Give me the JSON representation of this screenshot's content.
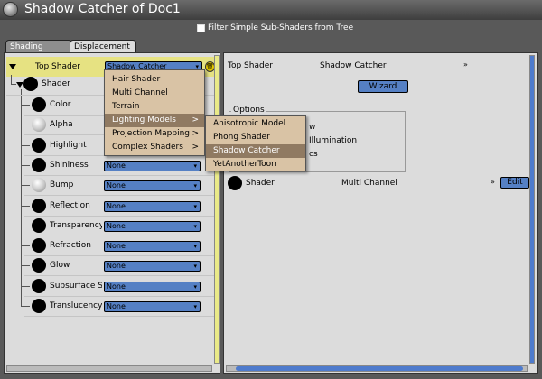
{
  "window": {
    "title": "Shadow Catcher of Doc1"
  },
  "filter": {
    "label": "Filter Simple Sub-Shaders from Tree"
  },
  "tabs": [
    "Shading",
    "Displacement"
  ],
  "top_shader": {
    "label": "Top Shader",
    "value": "Shadow Catcher"
  },
  "tree": {
    "shader_label": "Shader",
    "items": [
      {
        "label": "Color",
        "value": ""
      },
      {
        "label": "Alpha",
        "value": ""
      },
      {
        "label": "Highlight",
        "value": ""
      },
      {
        "label": "Shininess",
        "value": "None"
      },
      {
        "label": "Bump",
        "value": "None"
      },
      {
        "label": "Reflection",
        "value": "None"
      },
      {
        "label": "Transparency",
        "value": "None"
      },
      {
        "label": "Refraction",
        "value": "None"
      },
      {
        "label": "Glow",
        "value": "None"
      },
      {
        "label": "Subsurface Sc",
        "value": "None"
      },
      {
        "label": "Translucency",
        "value": "None"
      }
    ]
  },
  "menu": {
    "items": [
      "Hair Shader",
      "Multi Channel",
      "Terrain",
      "Lighting Models",
      "Projection Mapping",
      "Complex Shaders"
    ],
    "submenu_arrow": ">",
    "highlighted": "Lighting Models"
  },
  "submenu": {
    "items": [
      "Anisotropic Model",
      "Phong Shader",
      "Shadow Catcher",
      "YetAnotherToon"
    ],
    "highlighted": "Shadow Catcher"
  },
  "right": {
    "top_label": "Top Shader",
    "top_value": "Shadow Catcher",
    "wizard_label": "Wizard",
    "options_label": "Options",
    "options_partial": [
      "w",
      "Illumination",
      "cs"
    ],
    "shader_label": "Shader",
    "shader_value": "Multi Channel",
    "edit_label": "Edit"
  },
  "icons": {
    "trash": "trash-icon",
    "close": "close-icon",
    "chevron": "double-chevron-icon"
  },
  "colors": {
    "accent_blue": "#5580c4",
    "highlight_yellow": "#e6e282",
    "menu_bg": "#d9c3a5",
    "menu_highlight": "#907a62"
  }
}
